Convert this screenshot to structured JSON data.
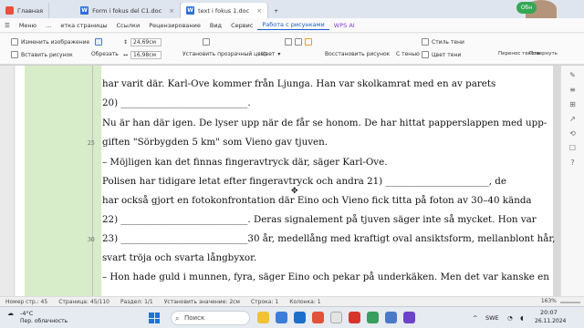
{
  "tabs": [
    {
      "label": "Главная",
      "icon": "home-icon"
    },
    {
      "label": "Form i fokus del C1.doc",
      "icon": "word-icon"
    },
    {
      "label": "text i fokus 1.doc",
      "icon": "word-icon",
      "active": true
    }
  ],
  "obn_label": "Обн",
  "webcam": {
    "name": "olesyadhekhorina"
  },
  "menu": {
    "file": "Меню",
    "items": [
      "...",
      "етка страницы",
      "Ссылки",
      "Рецензирование",
      "Вид",
      "Сервис",
      "Работа с рисунками",
      "WPS AI"
    ],
    "active_index": 6
  },
  "ribbon": {
    "change_image": "Изменить изображение",
    "insert_picture": "Вставить рисунок",
    "crop": "Обрезать",
    "height_value": "24,69см",
    "width_value": "16,98см",
    "transparent": "Установить прозрачный цвет",
    "color": "Цвет",
    "restore": "Восстановить рисунок",
    "shadow": "С тенью",
    "shadow_style": "Стиль тени",
    "shadow_color": "Цвет тени",
    "wrap": "Перенос текста",
    "rotate": "Повернуть"
  },
  "document": {
    "lines": [
      {
        "text": "har varit där. Karl-Ove kommer från Ljunga. Han var skolkamrat med en av parets",
        "num": ""
      },
      {
        "text": "20) ___________________________.",
        "num": ""
      },
      {
        "text": "    Nu är han där igen. De lyser upp när de får se honom. De har hittat papperslappen med upp-",
        "num": ""
      },
      {
        "text": "giften \"Sörbygden 5 km\" som Vieno gav tjuven.",
        "num": "25"
      },
      {
        "text": "    – Möjligen kan det finnas fingeravtryck där, säger Karl-Ove.",
        "num": ""
      },
      {
        "text": "    Polisen har tidigare letat efter fingeravtryck och andra 21) ______________________, de",
        "num": ""
      },
      {
        "text": "har också gjort en fotokonfrontation där Eino och Vieno fick titta på foton av 30–40 kända",
        "num": ""
      },
      {
        "text": "22) ___________________________. Deras signalement på tjuven säger inte så mycket. Hon var",
        "num": ""
      },
      {
        "text": "23) ___________________________30 år, medellång med kraftigt oval ansiktsform, mellanblont hår,",
        "num": "30"
      },
      {
        "text": "svart tröja och svarta långbyxor.",
        "num": ""
      },
      {
        "text": "    – Hon hade guld i munnen, fyra, säger Eino och pekar på underkäken. Men det var kanske en",
        "num": ""
      }
    ]
  },
  "status": {
    "page_num": "Номер стр.: 45",
    "pages": "Страница: 45/110",
    "section": "Раздел: 1/1",
    "setval": "Установить значение: 2см",
    "row": "Строка: 1",
    "col": "Колонка: 1",
    "zoom": "163%"
  },
  "taskbar": {
    "weather_temp": "-4°C",
    "weather_desc": "Пер. облачность",
    "search": "Поиск",
    "lang": "SWE",
    "time": "20:07",
    "date": "26.11.2024"
  }
}
